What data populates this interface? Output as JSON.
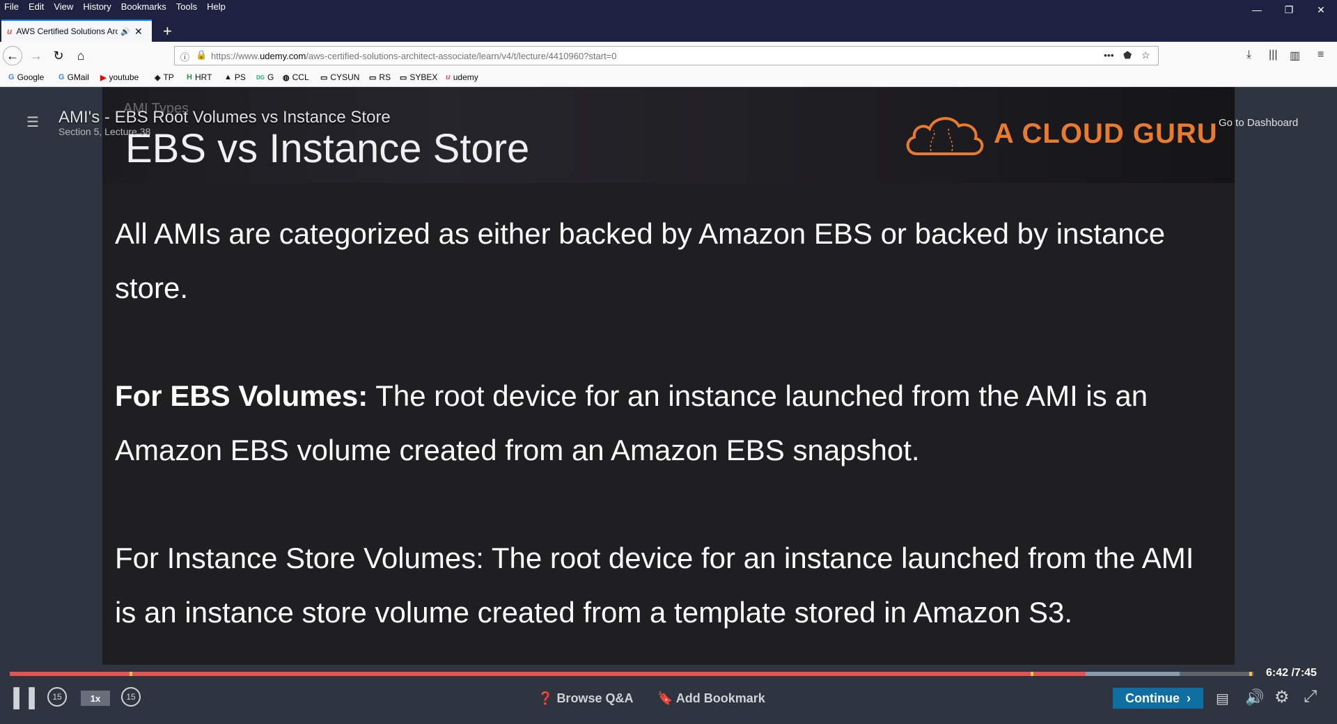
{
  "menubar": [
    "File",
    "Edit",
    "View",
    "History",
    "Bookmarks",
    "Tools",
    "Help"
  ],
  "window_controls": {
    "minimize": "—",
    "restore": "❐",
    "close": "✕"
  },
  "tab": {
    "title": "AWS Certified Solutions Arc",
    "favicon": "u",
    "audio_icon": "speaker-icon",
    "close": "✕"
  },
  "new_tab": "+",
  "url": {
    "prefix": "https://www.",
    "domain": "udemy.com",
    "path": "/aws-certified-solutions-architect-associate/learn/v4/t/lecture/4410960?start=0"
  },
  "bookmarks": [
    {
      "icon": "G",
      "label": "Google"
    },
    {
      "icon": "G",
      "label": "GMail"
    },
    {
      "icon": "▶",
      "label": "youtube"
    },
    {
      "icon": "◈",
      "label": "TP"
    },
    {
      "icon": "H",
      "label": "HRT"
    },
    {
      "icon": "▲",
      "label": "PS"
    },
    {
      "icon": "DG",
      "label": "G"
    },
    {
      "icon": "◍",
      "label": "CCL"
    },
    {
      "icon": "▭",
      "label": "CYSUN"
    },
    {
      "icon": "▭",
      "label": "RS"
    },
    {
      "icon": "▭",
      "label": "SYBEX"
    },
    {
      "icon": "u",
      "label": "udemy"
    }
  ],
  "lecture": {
    "title": "AMI's - EBS Root Volumes vs Instance Store",
    "subtitle": "Section 5, Lecture 38"
  },
  "dashboard_link": "Go to Dashboard",
  "slide": {
    "small_title": "AMI Types",
    "big_title": "EBS vs Instance Store",
    "logo_text": "A CLOUD GURU",
    "p1": "All AMIs are categorized as either backed by Amazon EBS or backed by instance store.",
    "p2_bold": "For EBS Volumes:",
    "p2_rest": " The root device for an instance launched from the AMI is an Amazon EBS volume created from an Amazon EBS snapshot.",
    "p3": "For Instance Store Volumes: The root device for an instance launched from the AMI is an instance store volume created from a template stored in Amazon S3."
  },
  "player": {
    "time": "6:42 /7:45",
    "progress_fraction": 0.865,
    "rewind": "15",
    "forward": "15",
    "rate": "1x",
    "browse_qa": "Browse Q&A",
    "add_bookmark": "Add Bookmark",
    "continue": "Continue",
    "accent": "#ec5252",
    "continue_color": "#0f6fa3"
  }
}
